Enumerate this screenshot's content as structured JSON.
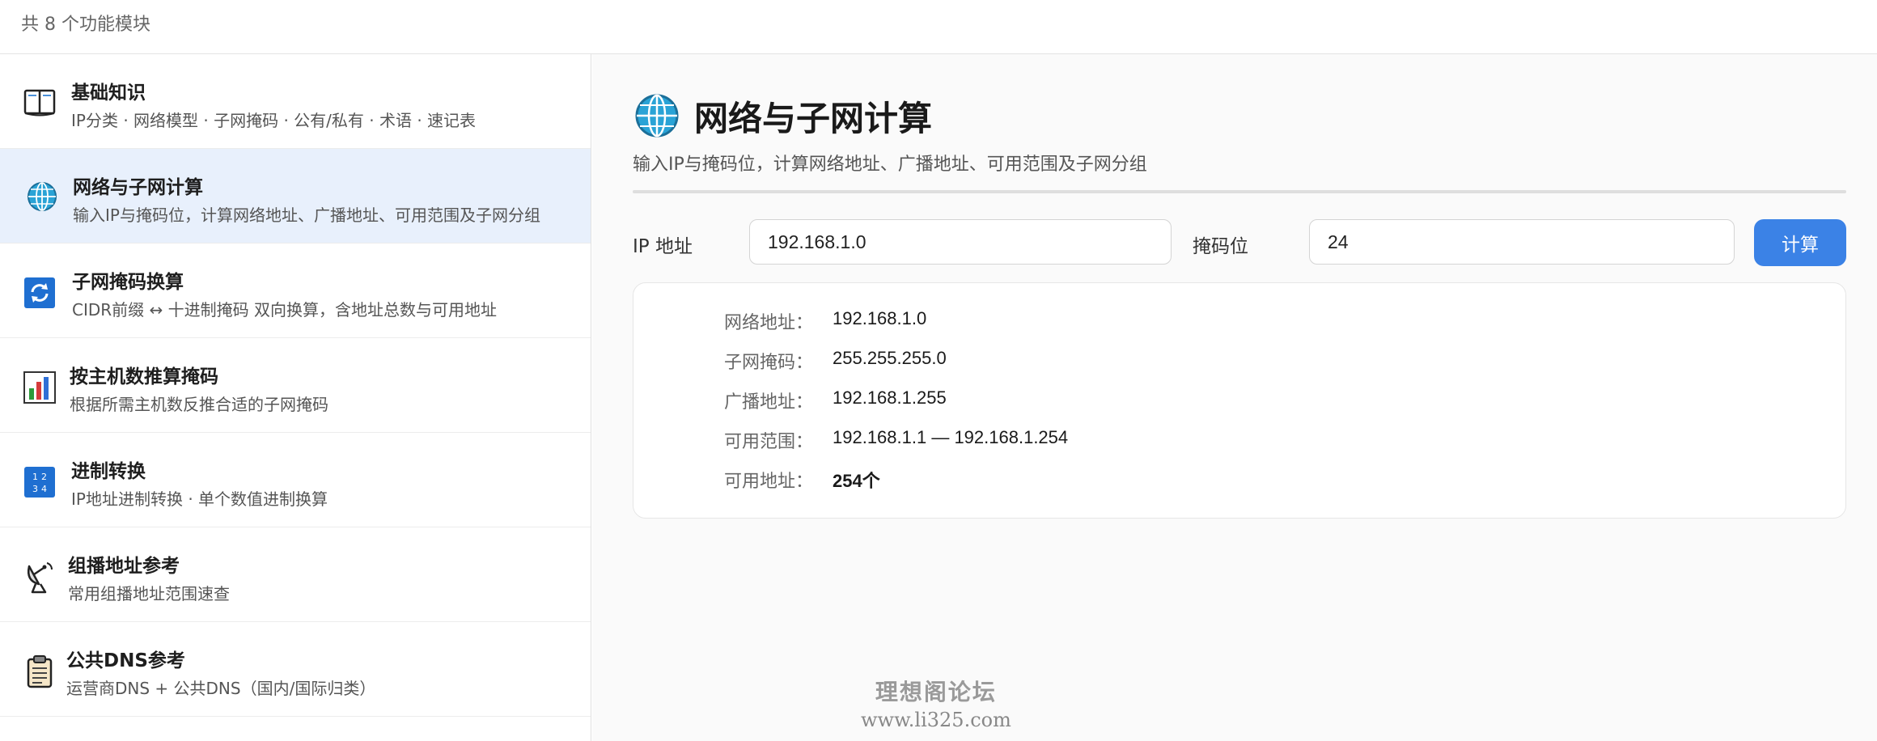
{
  "topbar": {
    "module_count": "共 8 个功能模块"
  },
  "sidebar": {
    "items": [
      {
        "title": "基础知识",
        "desc": "IP分类 · 网络模型 · 子网掩码 · 公有/私有 · 术语 · 速记表",
        "icon": "book-icon"
      },
      {
        "title": "网络与子网计算",
        "desc": "输入IP与掩码位，计算网络地址、广播地址、可用范围及子网分组",
        "icon": "globe-icon"
      },
      {
        "title": "子网掩码换算",
        "desc": "CIDR前缀 ↔ 十进制掩码 双向换算，含地址总数与可用地址",
        "icon": "refresh-icon"
      },
      {
        "title": "按主机数推算掩码",
        "desc": "根据所需主机数反推合适的子网掩码",
        "icon": "bar-chart-icon"
      },
      {
        "title": "进制转换",
        "desc": "IP地址进制转换 · 单个数值进制换算",
        "icon": "numbers-icon"
      },
      {
        "title": "组播地址参考",
        "desc": "常用组播地址范围速查",
        "icon": "satellite-dish-icon"
      },
      {
        "title": "公共DNS参考",
        "desc": "运营商DNS + 公共DNS（国内/国际归类）",
        "icon": "clipboard-icon"
      }
    ]
  },
  "main": {
    "title": "网络与子网计算",
    "subtitle": "输入IP与掩码位，计算网络地址、广播地址、可用范围及子网分组",
    "ip_label": "IP 地址",
    "ip_value": "192.168.1.0",
    "mask_label": "掩码位",
    "mask_value": "24",
    "calc_label": "计算",
    "results": [
      {
        "key": "网络地址：",
        "value": "192.168.1.0"
      },
      {
        "key": "子网掩码：",
        "value": "255.255.255.0"
      },
      {
        "key": "广播地址：",
        "value": "192.168.1.255"
      },
      {
        "key": "可用范围：",
        "value": "192.168.1.1 — 192.168.1.254"
      },
      {
        "key": "可用地址：",
        "value": "254个"
      }
    ]
  },
  "watermark": {
    "line1": "理想阁论坛",
    "line2": "www.li325.com"
  },
  "colors": {
    "accent": "#3b82e6",
    "active_bg": "#e8f0fc"
  }
}
